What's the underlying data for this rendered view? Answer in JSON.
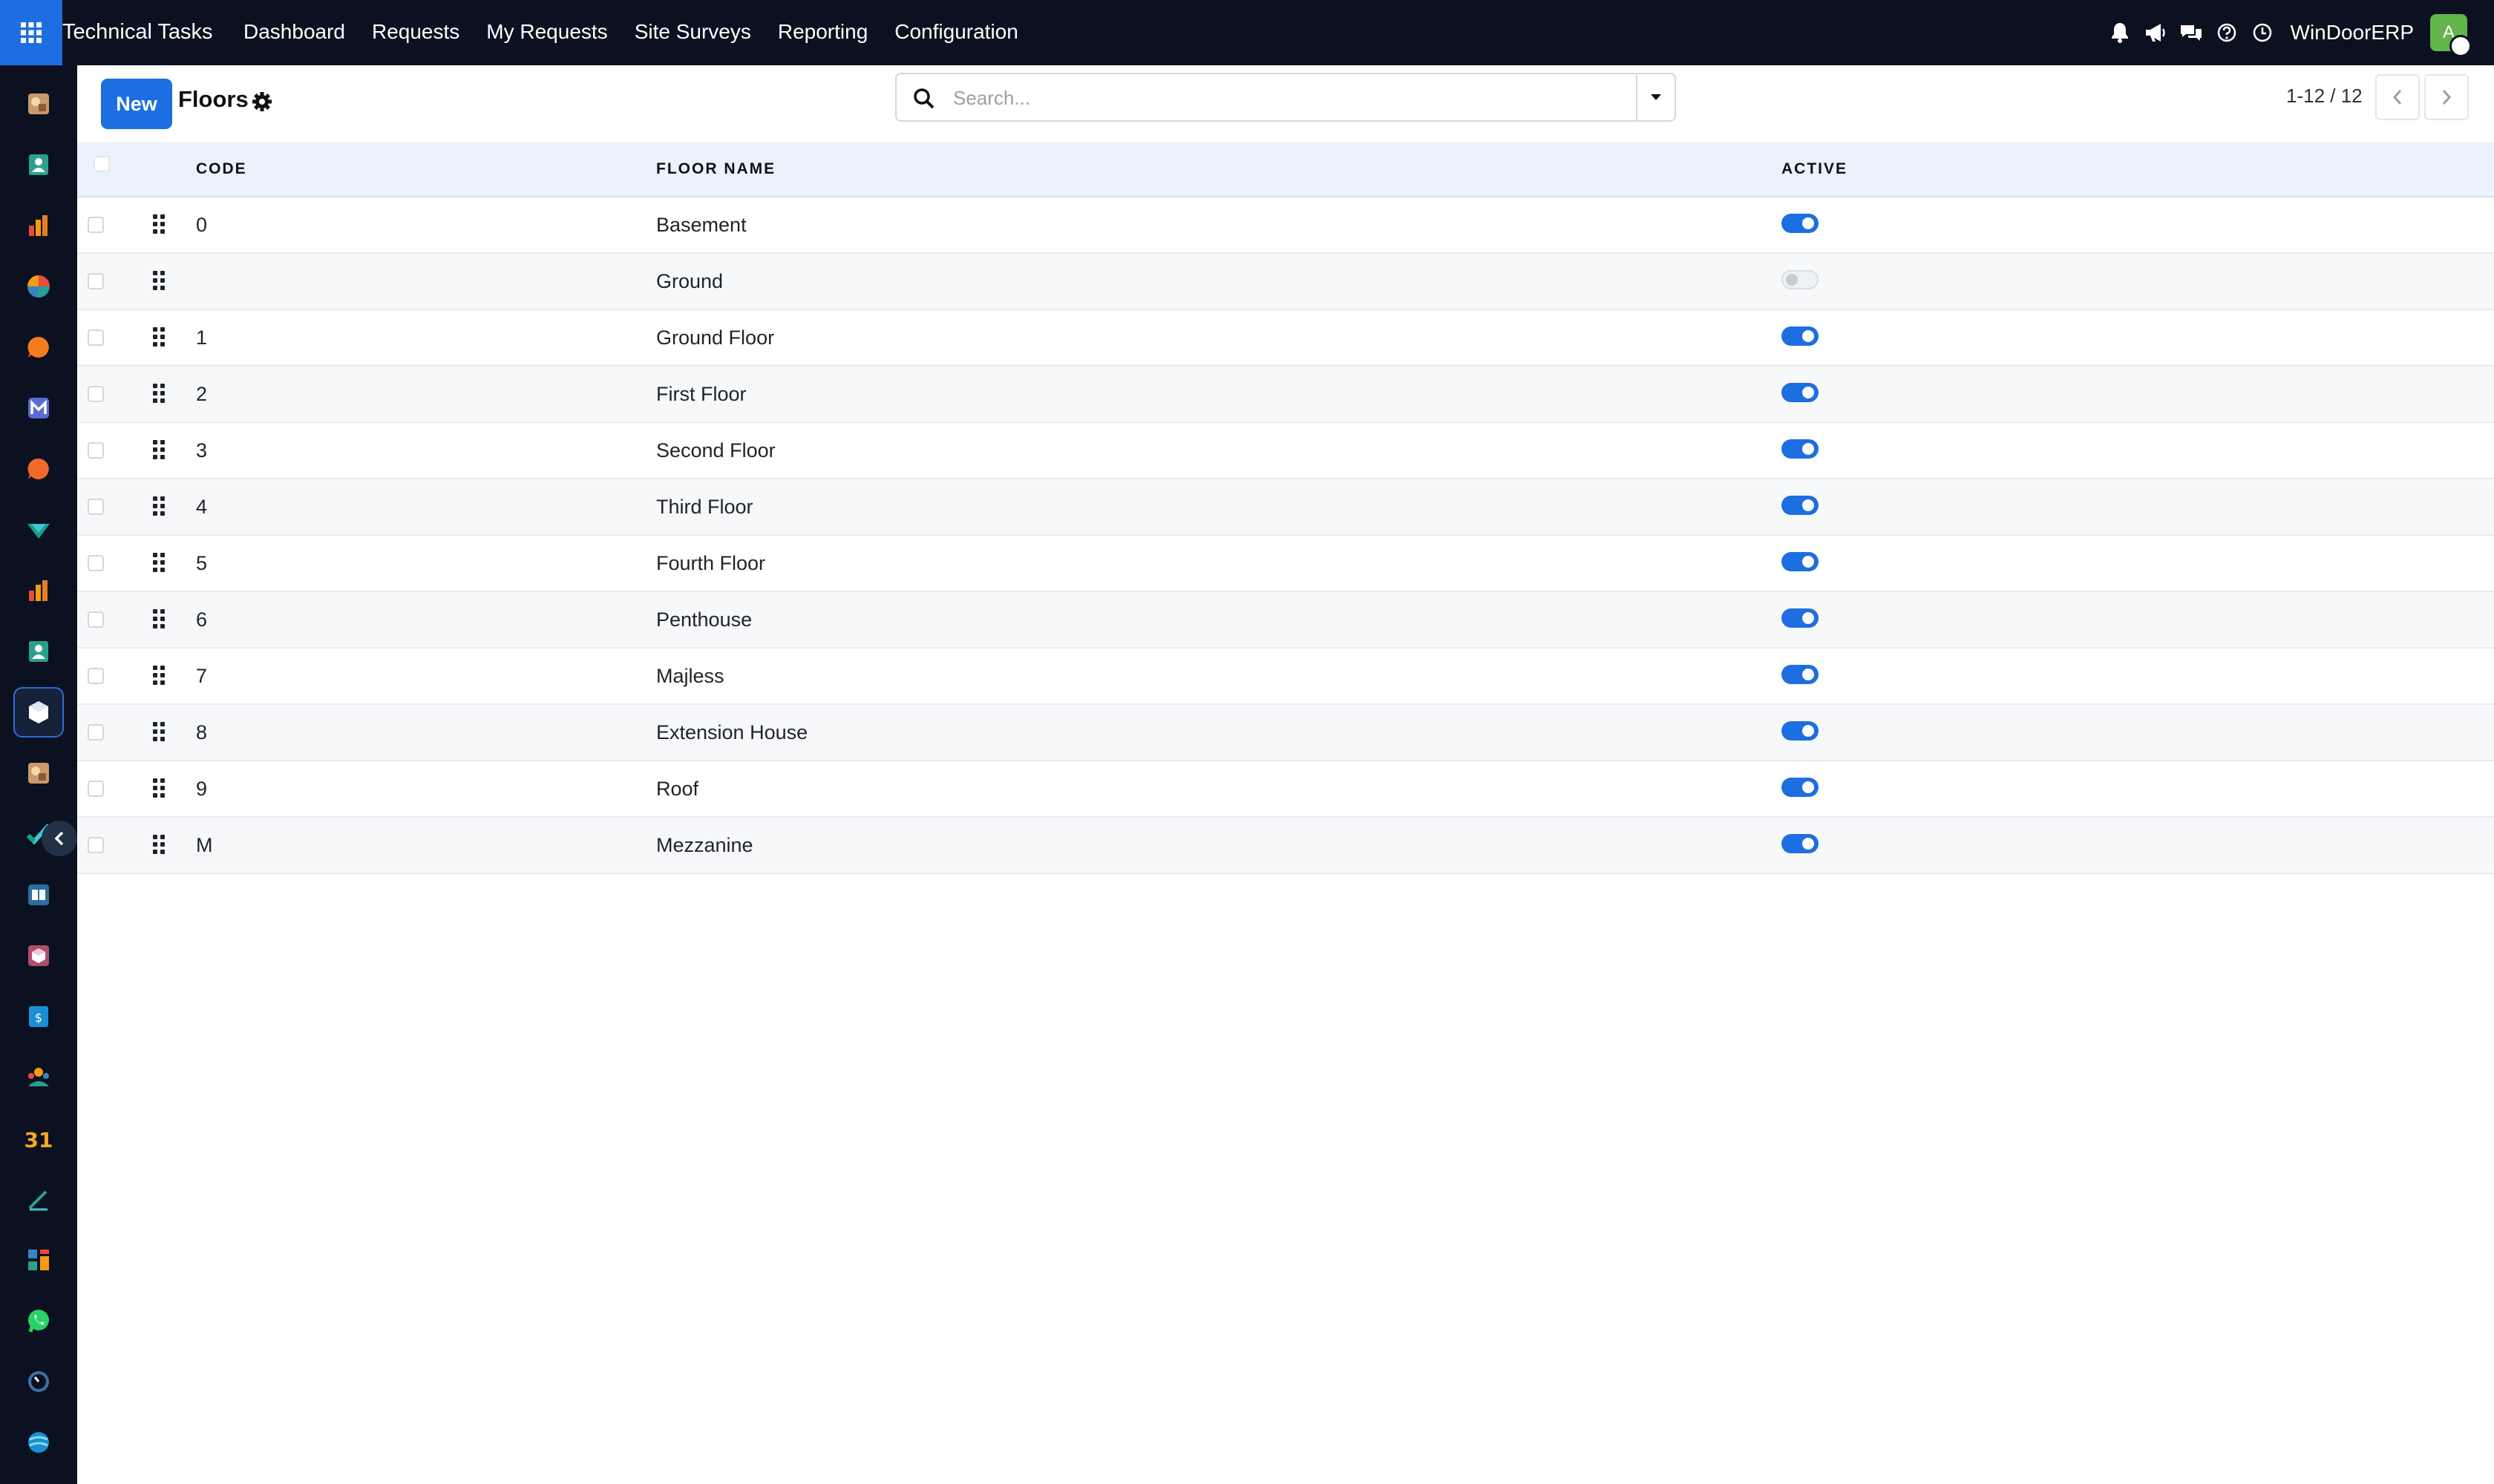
{
  "topbar": {
    "apps_icon": "grid-apps-icon",
    "app_title": "Technical Tasks",
    "nav": [
      {
        "label": "Dashboard"
      },
      {
        "label": "Requests"
      },
      {
        "label": "My Requests"
      },
      {
        "label": "Site Surveys"
      },
      {
        "label": "Reporting"
      },
      {
        "label": "Configuration"
      }
    ],
    "icons": [
      "bell-icon",
      "megaphone-icon",
      "chat-icon",
      "help-icon",
      "clock-icon"
    ],
    "company": "WinDoorERP",
    "user_initial": "A"
  },
  "sidebar": {
    "apps": [
      "discuss-app-icon",
      "contacts-app-icon",
      "reporting-app-icon",
      "dashboard-app-icon",
      "live-chat-app-icon",
      "mail-app-icon",
      "helpdesk-app-icon",
      "sign-app-icon",
      "analytics-app-icon",
      "employees-app-icon",
      "inventory-app-icon",
      "documents-app-icon",
      "project-app-icon",
      "knowledge-app-icon",
      "products-app-icon",
      "invoicing-app-icon",
      "team-app-icon",
      "calendar-app-icon",
      "notes-app-icon",
      "website-app-icon",
      "whatsapp-app-icon",
      "timer-app-icon",
      "surveys-app-icon"
    ],
    "active_index": 10
  },
  "control": {
    "new_label": "New",
    "title": "Floors",
    "search_placeholder": "Search...",
    "pager": "1-12 / 12"
  },
  "table": {
    "columns": {
      "code": "CODE",
      "name": "FLOOR NAME",
      "active": "ACTIVE"
    },
    "rows": [
      {
        "code": "0",
        "name": "Basement",
        "active": true
      },
      {
        "code": "",
        "name": "Ground",
        "active": false
      },
      {
        "code": "1",
        "name": "Ground Floor",
        "active": true
      },
      {
        "code": "2",
        "name": "First Floor",
        "active": true
      },
      {
        "code": "3",
        "name": "Second Floor",
        "active": true
      },
      {
        "code": "4",
        "name": "Third Floor",
        "active": true
      },
      {
        "code": "5",
        "name": "Fourth Floor",
        "active": true
      },
      {
        "code": "6",
        "name": "Penthouse",
        "active": true
      },
      {
        "code": "7",
        "name": "Majless",
        "active": true
      },
      {
        "code": "8",
        "name": "Extension House",
        "active": true
      },
      {
        "code": "9",
        "name": "Roof",
        "active": true
      },
      {
        "code": "M",
        "name": "Mezzanine",
        "active": true
      }
    ]
  },
  "colors": {
    "primary": "#1d6ee0",
    "navbar": "#0b1120",
    "header_bg": "#eaf2fc",
    "avatar": "#62b54a"
  }
}
